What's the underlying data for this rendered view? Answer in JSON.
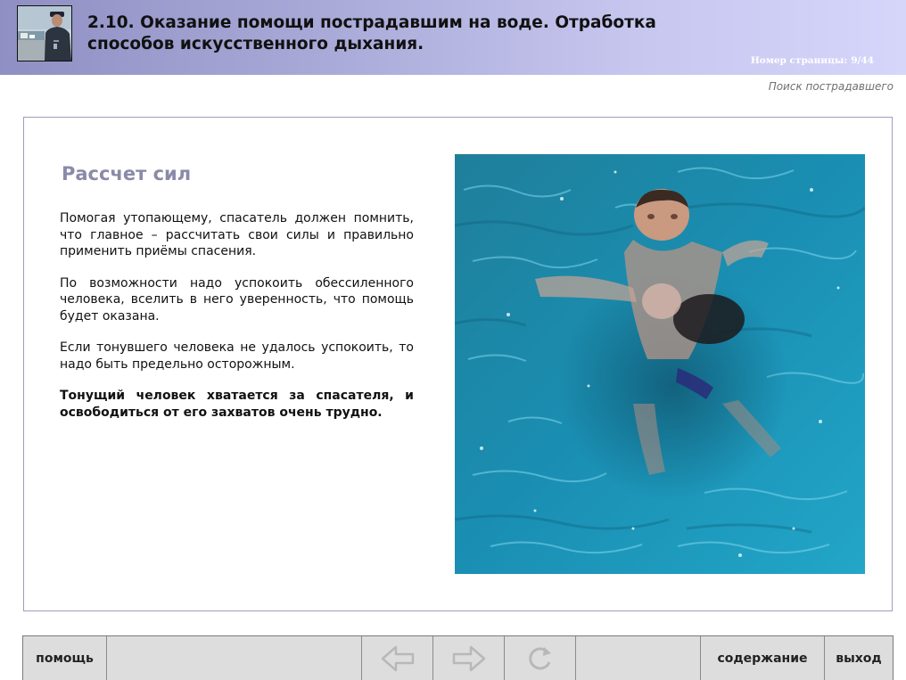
{
  "header": {
    "title": "2.10. Оказание помощи пострадавшим на воде. Отработка способов искусственного дыхания.",
    "page_label": "Номер страницы:",
    "page_value": "9/44",
    "photo_icon": "rescuer-photo",
    "colors": {
      "gradient_start": "#8f8fc3",
      "gradient_end": "#d6d6fb"
    }
  },
  "section": {
    "label": "Поиск пострадавшего"
  },
  "content": {
    "heading": "Рассчет сил",
    "paragraphs": [
      "Помогая утопающему, спасатель должен помнить, что главное – рассчитать свои силы и правильно применить приёмы спасения.",
      "По возможности надо успокоить обессиленного человека, вселить в него уверенность, что  помощь будет оказана.",
      "Если тонувшего человека не удалось успокоить, то надо быть предельно осторожным."
    ],
    "bold_paragraph": "Тонущий человек хватается за спасателя, и освободиться от его захватов очень трудно.",
    "photo_icon": "water-rescue-photo",
    "heading_color": "#8a8aa8"
  },
  "nav": {
    "help_label": "помощь",
    "back_icon": "arrow-left-icon",
    "forward_icon": "arrow-right-icon",
    "reload_icon": "reload-icon",
    "contents_label": "содержание",
    "exit_label": "выход"
  }
}
